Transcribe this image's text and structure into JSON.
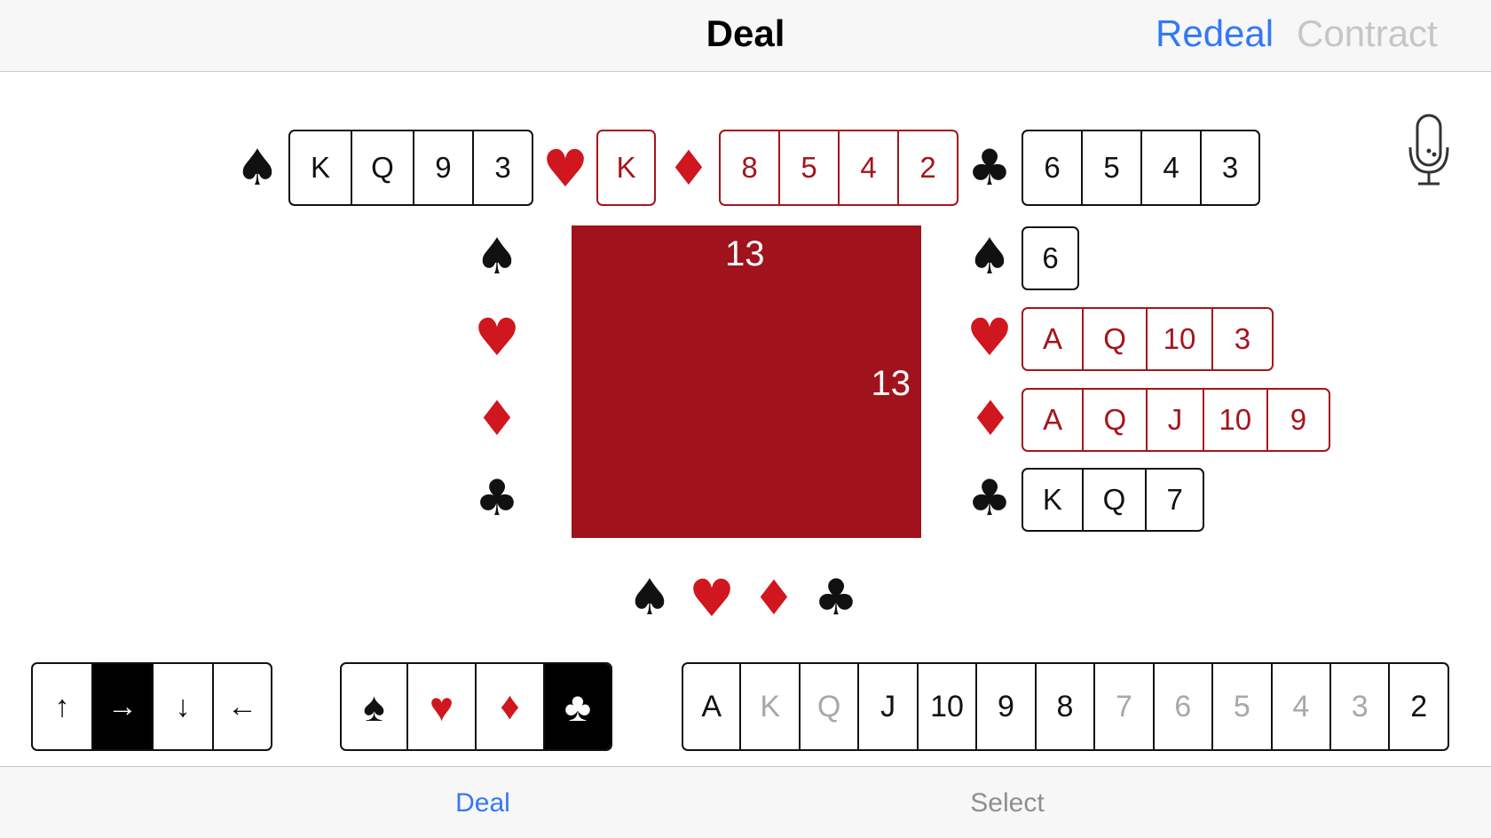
{
  "navbar": {
    "title": "Deal",
    "redeal_label": "Redeal",
    "contract_label": "Contract"
  },
  "north": {
    "spades": [
      "K",
      "Q",
      "9",
      "3"
    ],
    "hearts": [
      "K"
    ],
    "diamonds": [
      "8",
      "5",
      "4",
      "2"
    ],
    "clubs": [
      "6",
      "5",
      "4",
      "3"
    ]
  },
  "east": {
    "spades": [
      "6"
    ],
    "hearts": [
      "A",
      "Q",
      "10",
      "3"
    ],
    "diamonds": [
      "A",
      "Q",
      "J",
      "10",
      "9"
    ],
    "clubs": [
      "K",
      "Q",
      "7"
    ]
  },
  "table": {
    "north_count": "13",
    "east_count": "13"
  },
  "suits": {
    "spade": "♠",
    "heart": "♥",
    "diamond": "♦",
    "club": "♣"
  },
  "direction_control": {
    "options": [
      "↑",
      "→",
      "↓",
      "←"
    ],
    "selected": "→"
  },
  "suit_control": {
    "selected": "club"
  },
  "rank_control": {
    "ranks": [
      "A",
      "K",
      "Q",
      "J",
      "10",
      "9",
      "8",
      "7",
      "6",
      "5",
      "4",
      "3",
      "2"
    ],
    "available": [
      "A",
      "J",
      "10",
      "9",
      "8",
      "2"
    ]
  },
  "tabs": {
    "deal_label": "Deal",
    "select_label": "Select"
  },
  "colors": {
    "accent": "#3478f6",
    "table": "#a1131c",
    "red_suit": "#d0161e",
    "red_card": "#a5151d"
  },
  "icons": {
    "mic": "microphone-icon"
  }
}
